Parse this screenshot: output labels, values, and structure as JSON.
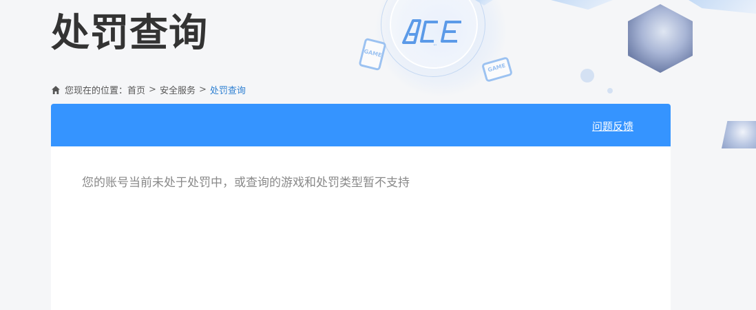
{
  "page": {
    "title": "处罚查询"
  },
  "decoration": {
    "logo_text": "ACE",
    "game_tag": "GAME",
    "colors": {
      "accent": "#3594ff",
      "logo_blue": "#5b9ae8"
    }
  },
  "breadcrumb": {
    "home_icon": "home-icon",
    "prefix": "您现在的位置：",
    "items": [
      {
        "label": "首页"
      },
      {
        "label": "安全服务"
      },
      {
        "label": "处罚查询",
        "current": true
      }
    ],
    "separator": ">"
  },
  "panel": {
    "header_color": "#3594ff",
    "feedback_label": "问题反馈",
    "message": "您的账号当前未处于处罚中，或查询的游戏和处罚类型暂不支持"
  }
}
